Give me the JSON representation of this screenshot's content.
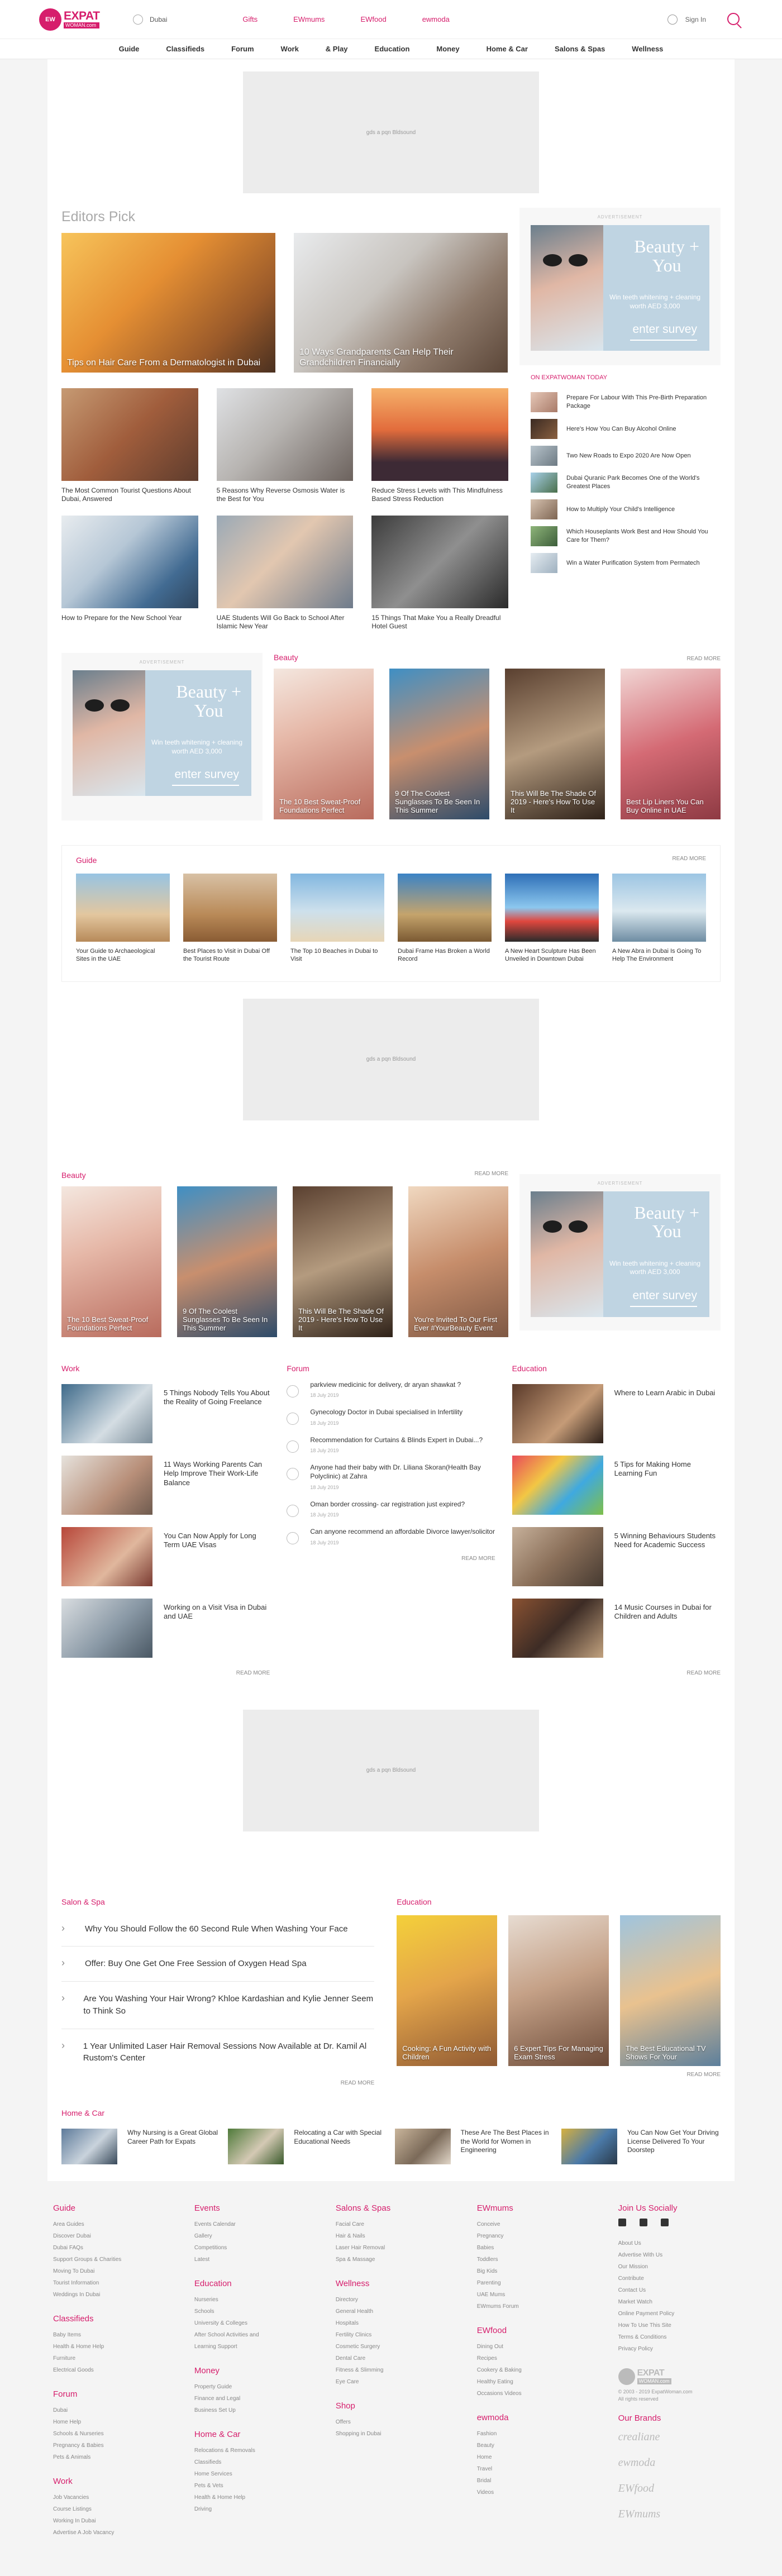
{
  "header": {
    "logo_main": "EXPAT",
    "logo_sub": "WOMAN.com",
    "location": "Dubai",
    "topnav": [
      "Gifts",
      "EWmums",
      "EWfood",
      "ewmoda"
    ],
    "signin": "Sign In"
  },
  "mainnav": [
    "Guide",
    "Classifieds",
    "Forum",
    "Work",
    "& Play",
    "Education",
    "Money",
    "Home & Car",
    "Salons & Spas",
    "Wellness"
  ],
  "ad": {
    "label": "gds a pqn Bldsound"
  },
  "editors_pick": {
    "title": "Editors Pick",
    "featured": [
      "Tips on Hair Care From a Dermatologist in Dubai",
      "10 Ways Grandparents Can Help Their Grandchildren Financially"
    ],
    "grid": [
      "The Most Common Tourist Questions About Dubai, Answered",
      "5 Reasons Why Reverse Osmosis Water is the Best for You",
      "Reduce Stress Levels with This Mindfulness Based Stress Reduction",
      "How to Prepare for the New School Year",
      "UAE Students Will Go Back to School After Islamic New Year",
      "15 Things That Make You a Really Dreadful Hotel Guest"
    ]
  },
  "promo": {
    "label": "ADVERTISEMENT",
    "title_1": "Beauty +",
    "title_2": "You",
    "sub": "Win teeth whitening + cleaning worth AED 3,000",
    "cta": "enter survey"
  },
  "today": {
    "title": "ON EXPATWOMAN TODAY",
    "items": [
      "Prepare For Labour With This Pre-Birth Preparation Package",
      "Here's How You Can Buy Alcohol Online",
      "Two New Roads to Expo 2020 Are Now Open",
      "Dubai Quranic Park Becomes One of the World's Greatest Places",
      "How to Multiply Your Child's Intelligence",
      "Which Houseplants Work Best and How Should You Care for Them?",
      "Win a Water Purification System from Permatech"
    ]
  },
  "beauty": {
    "title": "Beauty",
    "read_more": "READ MORE",
    "items": [
      "The 10 Best Sweat-Proof Foundations Perfect",
      "9 Of The Coolest Sunglasses To Be Seen In This Summer",
      "This Will Be The Shade Of 2019 - Here's How To Use It",
      "Best Lip Liners You Can Buy Online in UAE"
    ]
  },
  "guide": {
    "title": "Guide",
    "read_more": "READ MORE",
    "items": [
      "Your Guide to Archaeological Sites in the UAE",
      "Best Places to Visit in Dubai Off the Tourist Route",
      "The Top 10 Beaches in Dubai to Visit",
      "Dubai Frame Has Broken a World Record",
      "A New Heart Sculpture Has Been Unveiled in Downtown Dubai",
      "A New Abra in Dubai Is Going To Help The Environment"
    ]
  },
  "beauty2": {
    "title": "Beauty",
    "read_more": "READ MORE",
    "items": [
      "The 10 Best Sweat-Proof Foundations Perfect",
      "9 Of The Coolest Sunglasses To Be Seen In This Summer",
      "This Will Be The Shade Of 2019 - Here's How To Use It",
      "You're Invited To Our First Ever #YourBeauty Event"
    ]
  },
  "work": {
    "title": "Work",
    "read_more": "READ MORE",
    "items": [
      "5 Things Nobody Tells You About the Reality of Going Freelance",
      "11 Ways Working Parents Can Help Improve Their Work-Life Balance",
      "You Can Now Apply for Long Term UAE Visas",
      "Working on a Visit Visa in Dubai and UAE"
    ]
  },
  "forum": {
    "title": "Forum",
    "read_more": "READ MORE",
    "items": [
      {
        "t": "parkview medicinic for delivery, dr aryan shawkat ?",
        "d": "18 July 2019"
      },
      {
        "t": "Gynecology Doctor in Dubai specialised in Infertility",
        "d": "18 July 2019"
      },
      {
        "t": "Recommendation for Curtains & Blinds Expert in Dubai...?",
        "d": "18 July 2019"
      },
      {
        "t": "Anyone had their baby with Dr. Liliana Skoran(Health Bay Polyclinic) at Zahra",
        "d": "18 July 2019"
      },
      {
        "t": "Oman border crossing- car registration just expired?",
        "d": "18 July 2019"
      },
      {
        "t": "Can anyone recommend an affordable Divorce lawyer/solicitor",
        "d": "18 July 2019"
      }
    ]
  },
  "education": {
    "title": "Education",
    "read_more": "READ MORE",
    "items": [
      "Where to Learn Arabic in Dubai",
      "5 Tips for Making Home Learning Fun",
      "5 Winning Behaviours Students Need for Academic Success",
      "14 Music Courses in Dubai for Children and Adults"
    ]
  },
  "salons": {
    "title": "Salon & Spa",
    "read_more": "READ MORE",
    "items": [
      "Why You Should Follow the 60 Second Rule When Washing Your Face",
      "Offer: Buy One Get One Free Session of Oxygen Head Spa",
      "Are You Washing Your Hair Wrong? Khloe Kardashian and Kylie Jenner Seem to Think So",
      "1 Year Unlimited Laser Hair Removal Sessions Now Available at Dr. Kamil Al Rustom's Center"
    ]
  },
  "education2": {
    "title": "Education",
    "read_more": "READ MORE",
    "items": [
      "Cooking: A Fun Activity with Children",
      "6 Expert Tips For Managing Exam Stress",
      "The Best Educational TV Shows For Your"
    ]
  },
  "homecar": {
    "title": "Home & Car",
    "items": [
      "Why Nursing is a Great Global Career Path for Expats",
      "Relocating a Car with Special Educational Needs",
      "These Are The Best Places in the World for Women in Engineering",
      "You Can Now Get Your Driving License Delivered To Your Doorstep"
    ]
  },
  "footer": {
    "cols": [
      [
        {
          "h": "Guide",
          "items": [
            "Area Guides",
            "Discover Dubai",
            "Dubai FAQs",
            "Support Groups & Charities",
            "Moving To Dubai",
            "Tourist Information",
            "Weddings In Dubai"
          ]
        },
        {
          "h": "Classifieds",
          "items": [
            "Baby Items",
            "Health & Home Help",
            "Furniture",
            "Electrical Goods"
          ]
        },
        {
          "h": "Forum",
          "items": [
            "Dubai",
            "Home Help",
            "Schools & Nurseries",
            "Pregnancy & Babies",
            "Pets & Animals"
          ]
        },
        {
          "h": "Work",
          "items": [
            "Job Vacancies",
            "Course Listings",
            "Working In Dubai",
            "Advertise A Job Vacancy"
          ]
        }
      ],
      [
        {
          "h": "Events",
          "items": [
            "Events Calendar",
            "Gallery",
            "Competitions",
            "Latest"
          ]
        },
        {
          "h": "Education",
          "items": [
            "Nurseries",
            "Schools",
            "University & Colleges",
            "After School Activities and",
            "Learning Support"
          ]
        },
        {
          "h": "Money",
          "items": [
            "Property Guide",
            "Finance and Legal",
            "Business Set Up"
          ]
        },
        {
          "h": "Home & Car",
          "items": [
            "Relocations & Removals",
            "Classifieds",
            "Home Services",
            "Pets & Vets",
            "Health & Home Help",
            "Driving"
          ]
        }
      ],
      [
        {
          "h": "Salons & Spas",
          "items": [
            "Facial Care",
            "Hair & Nails",
            "Laser Hair Removal",
            "Spa & Massage"
          ]
        },
        {
          "h": "Wellness",
          "items": [
            "Directory",
            "General Health",
            "Hospitals",
            "Fertility Clinics",
            "Cosmetic Surgery",
            "Dental Care",
            "Fitness & Slimming",
            "Eye Care"
          ]
        },
        {
          "h": "Shop",
          "items": [
            "Offers",
            "Shopping in Dubai"
          ]
        }
      ],
      [
        {
          "h": "EWmums",
          "items": [
            "Conceive",
            "Pregnancy",
            "Babies",
            "Toddlers",
            "Big Kids",
            "Parenting",
            "UAE Mums",
            "EWmums Forum"
          ]
        },
        {
          "h": "EWfood",
          "items": [
            "Dining Out",
            "Recipes",
            "Cookery & Baking",
            "Healthy Eating",
            "Occasions Videos"
          ]
        },
        {
          "h": "ewmoda",
          "items": [
            "Fashion",
            "Beauty",
            "Home",
            "Travel",
            "Bridal",
            "Videos"
          ]
        }
      ]
    ],
    "social_title": "Join Us Socially",
    "about_links": [
      "About Us",
      "Advertise With Us",
      "Our Mission",
      "Contribute",
      "Contact Us",
      "Market Watch",
      "Online Payment Policy",
      "How To Use This Site",
      "Terms & Conditions",
      "Privacy Policy"
    ],
    "copyright": "© 2003 - 2019 ExpatWoman.com",
    "rights": "All rights reserved",
    "brands_title": "Our Brands",
    "brands": [
      "crealiane",
      "ewmoda",
      "EWfood",
      "EWmums"
    ]
  }
}
